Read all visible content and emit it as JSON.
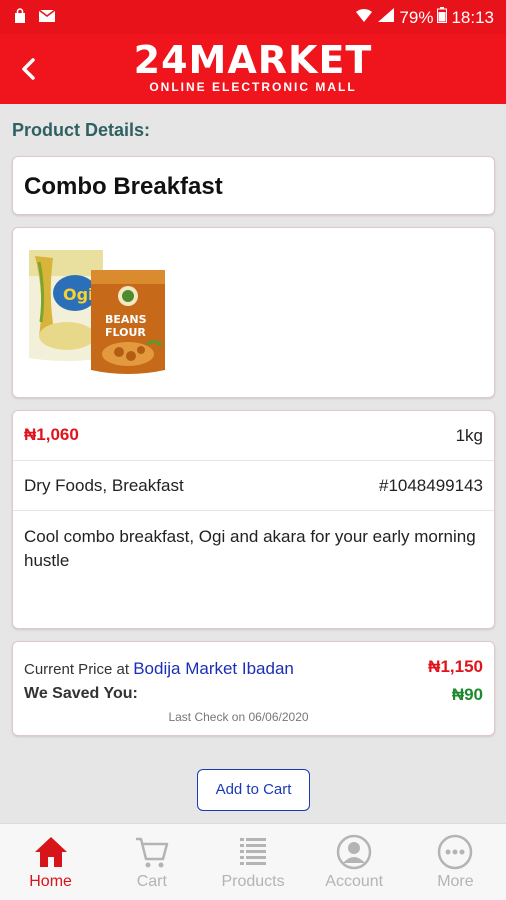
{
  "status_bar": {
    "battery": "79%",
    "time": "18:13"
  },
  "header": {
    "brand_title": "24MARKET",
    "brand_subtitle": "ONLINE ELECTRONIC MALL"
  },
  "section_title": "Product Details:",
  "product": {
    "name": "Combo Breakfast",
    "price": "₦1,060",
    "weight": "1kg",
    "category": "Dry Foods, Breakfast",
    "sku": "#1048499143",
    "description": "Cool combo breakfast, Ogi and akara for your early morning hustle"
  },
  "market": {
    "current_price_label": "Current Price at",
    "market_name": "Bodija Market Ibadan",
    "current_price": "₦1,150",
    "saved_label": "We Saved You:",
    "saved_amount": "₦90",
    "last_check": "Last Check on 06/06/2020"
  },
  "actions": {
    "add_to_cart": "Add to Cart"
  },
  "bottom_nav": [
    {
      "label": "Home",
      "icon": "home-icon",
      "active": true
    },
    {
      "label": "Cart",
      "icon": "cart-icon",
      "active": false
    },
    {
      "label": "Products",
      "icon": "list-icon",
      "active": false
    },
    {
      "label": "Account",
      "icon": "account-icon",
      "active": false
    },
    {
      "label": "More",
      "icon": "more-icon",
      "active": false
    }
  ],
  "colors": {
    "brand_red": "#f0141d",
    "price_red": "#e2141b",
    "saved_green": "#1f8a2d",
    "link_blue": "#1a2fb5"
  }
}
